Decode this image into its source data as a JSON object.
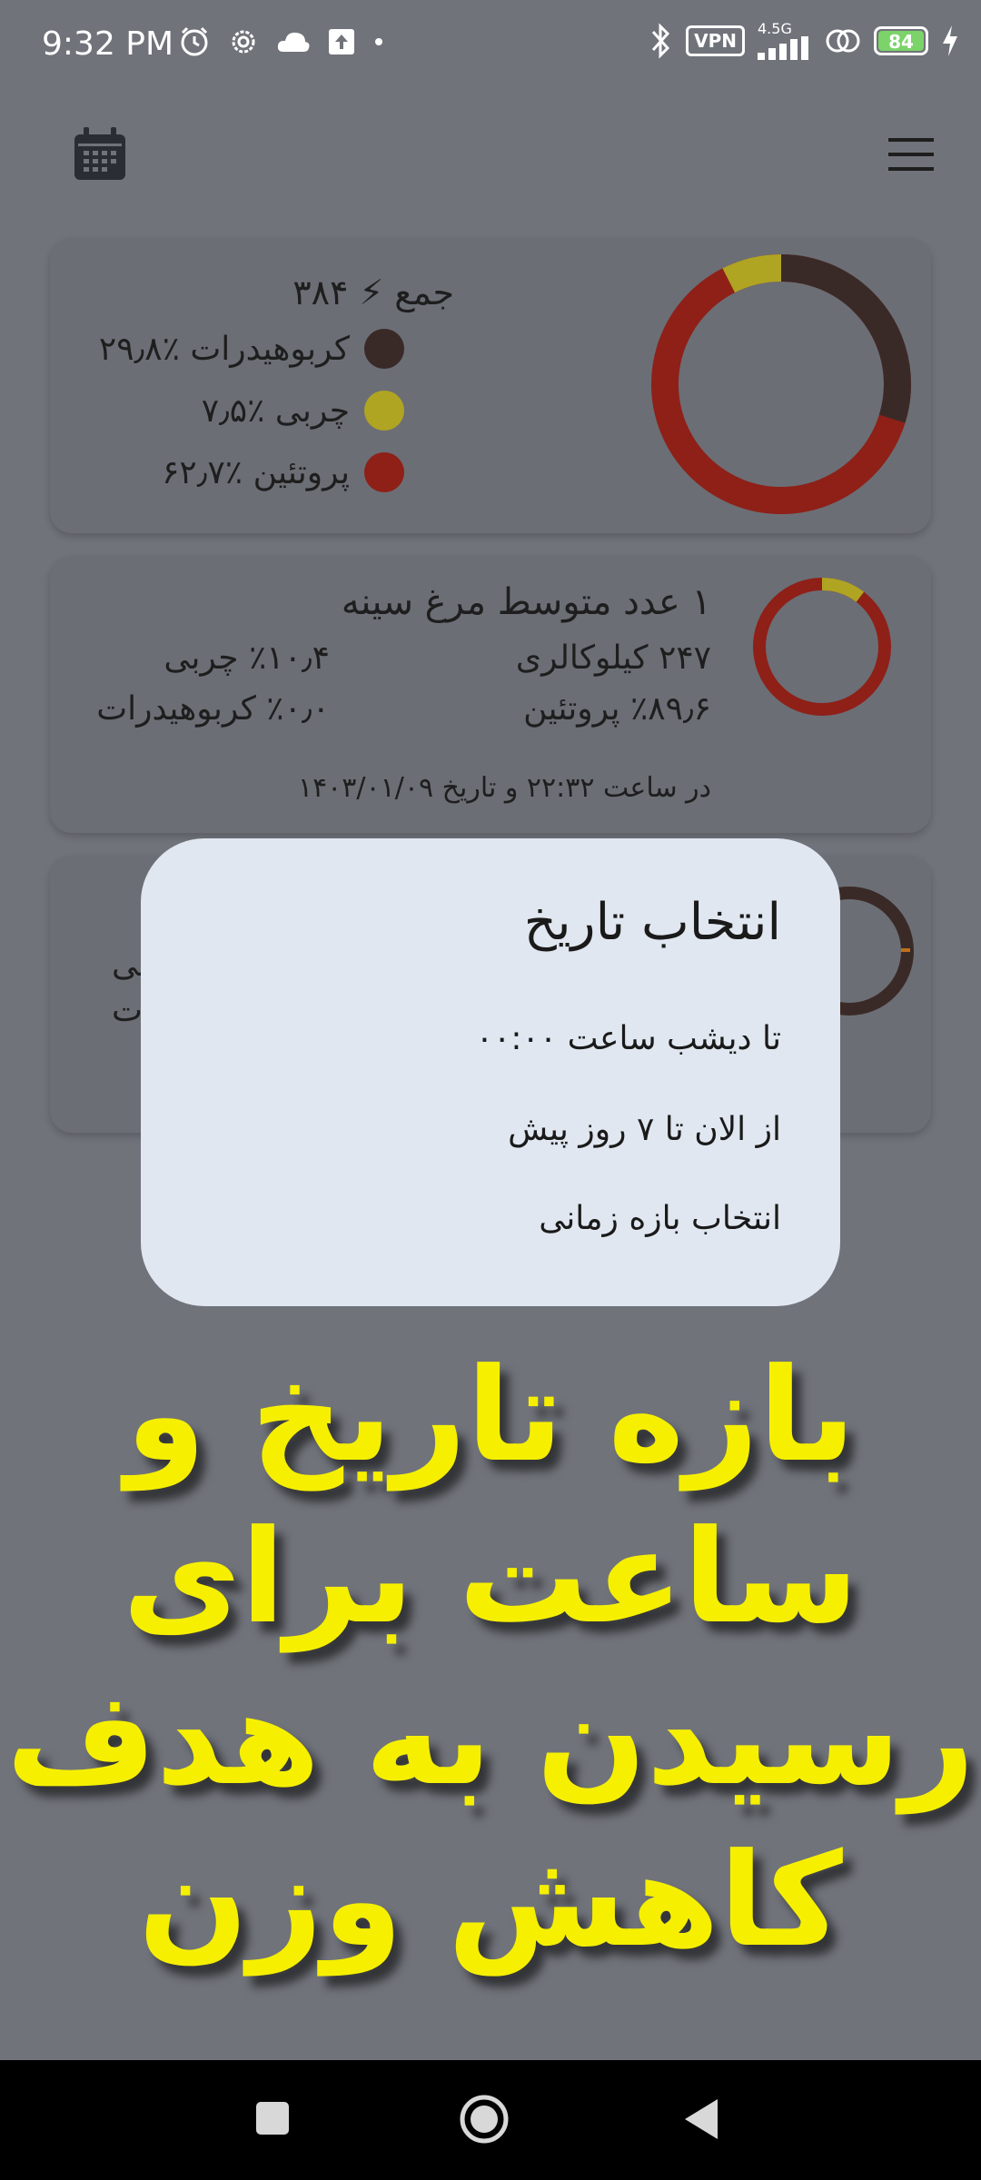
{
  "status_bar": {
    "time": "9:32 PM",
    "vpn": "VPN",
    "network": "4.5G",
    "battery": "84",
    "icons_left": [
      "alarm-icon",
      "settings-icon",
      "cloud-icon",
      "upload-icon",
      "dot-icon"
    ],
    "icons_right": [
      "bluetooth-icon",
      "vpn-icon",
      "signal-icon",
      "hotspot-icon",
      "battery-icon",
      "charging-icon"
    ]
  },
  "topbar": {
    "left_icon": "calendar-icon",
    "right_icon": "menu-icon"
  },
  "summary_card": {
    "total_label": "جمع ⚡ ۳۸۴",
    "legend": [
      {
        "label": "کربوهیدرات ٪۲۹٫۸",
        "color": "#3a2a27",
        "percent": 29.8
      },
      {
        "label": "چربی ٪۷٫۵",
        "color": "#b0a423",
        "percent": 7.5
      },
      {
        "label": "پروتئین ٪۶۲٫۷",
        "color": "#8e2018",
        "percent": 62.7
      }
    ]
  },
  "meal_card": {
    "title": "۱ عدد متوسط مرغ سینه",
    "calories": "۲۴۷ کیلوکالری",
    "protein": "٪۸۹٫۶ پروتئین",
    "fat": "٪۱۰٫۴ چربی",
    "carbs": "٪۰٫۰ کربوهیدرات",
    "timestamp": "در ساعت ۲۲:۳۲ و تاریخ ۱۴۰۳/۰۱/۰۹",
    "ring": {
      "protein": 89.6,
      "fat": 10.4,
      "carbs": 0.0
    }
  },
  "partial_card": {
    "line1": "بی",
    "line2": "ت"
  },
  "dialog": {
    "title": "انتخاب تاریخ",
    "options": [
      "تا دیشب ساعت ۰۰:۰۰",
      "از الان تا ۷ روز پیش",
      "انتخاب بازه زمانی"
    ]
  },
  "overlay_caption": {
    "lines": [
      "بازه تاریخ و",
      "ساعت برای",
      "رسیدن به هدف",
      "کاهش وزن"
    ]
  },
  "nav_bar": {
    "buttons": [
      "recents-button",
      "home-button",
      "back-button"
    ]
  }
}
